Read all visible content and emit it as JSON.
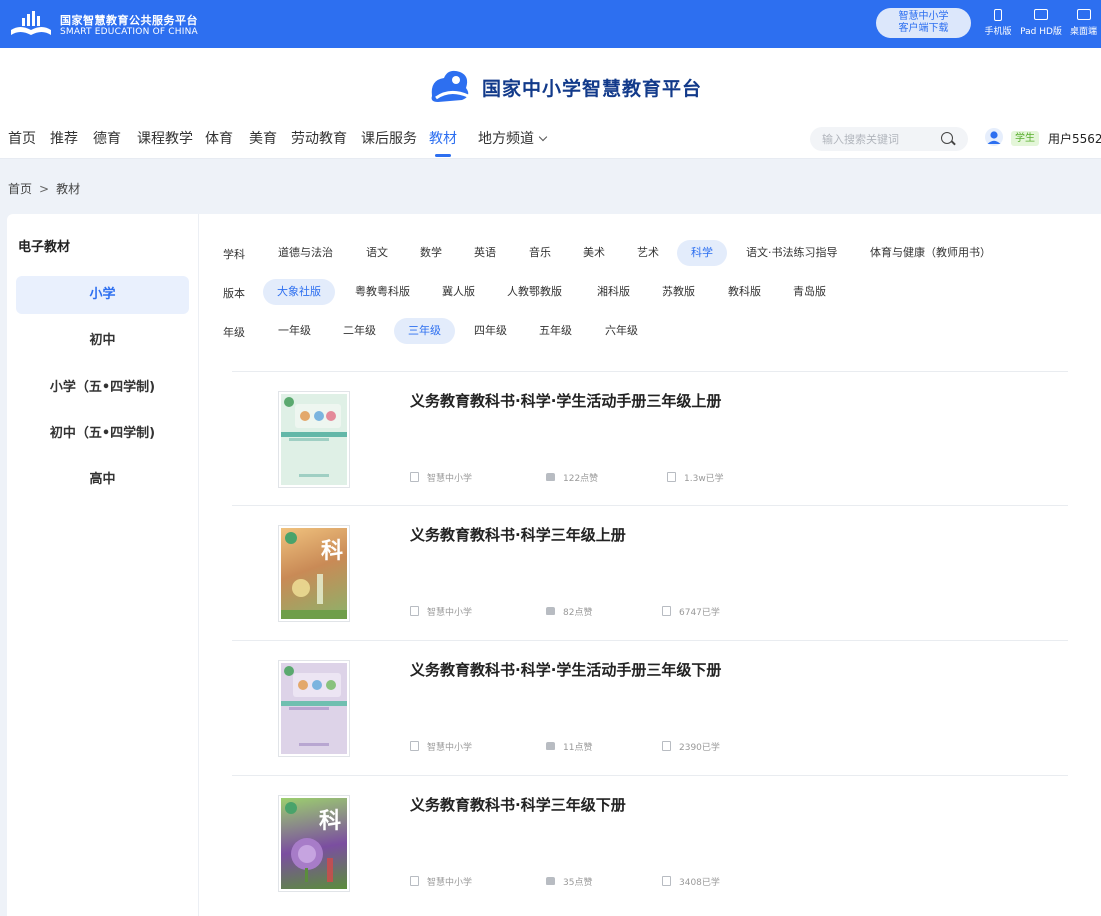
{
  "topbar": {
    "logo_cn": "国家智慧教育公共服务平台",
    "logo_en": "SMART EDUCATION OF CHINA",
    "download_line1": "智慧中小学",
    "download_line2": "客户端下载",
    "devices": [
      "手机版",
      "Pad HD版",
      "桌面端"
    ]
  },
  "header": {
    "brand": "国家中小学智慧教育平台",
    "nav": [
      "首页",
      "推荐",
      "德育",
      "课程教学",
      "体育",
      "美育",
      "劳动教育",
      "课后服务",
      "教材",
      "地方频道"
    ],
    "active_nav": "教材",
    "search_placeholder": "输入搜索关键词",
    "role": "学生",
    "username": "用户5562"
  },
  "breadcrumb": {
    "home": "首页",
    "sep": ">",
    "current": "教材"
  },
  "sidebar": {
    "title": "电子教材",
    "items": [
      "小学",
      "初中",
      "小学（五•四学制)",
      "初中（五•四学制)",
      "高中"
    ],
    "active": "小学"
  },
  "filters": {
    "subject_label": "学科",
    "subjects": [
      "道德与法治",
      "语文",
      "数学",
      "英语",
      "音乐",
      "美术",
      "艺术",
      "科学",
      "语文·书法练习指导",
      "体育与健康（教师用书）"
    ],
    "active_subject": "科学",
    "edition_label": "版本",
    "editions": [
      "大象社版",
      "粤教粤科版",
      "冀人版",
      "人教鄂教版",
      "湘科版",
      "苏教版",
      "教科版",
      "青岛版"
    ],
    "active_edition": "大象社版",
    "grade_label": "年级",
    "grades": [
      "一年级",
      "二年级",
      "三年级",
      "四年级",
      "五年级",
      "六年级"
    ],
    "active_grade": "三年级"
  },
  "books": [
    {
      "title": "义务教育教科书·科学·学生活动手册三年级上册",
      "source": "智慧中小学",
      "likes": "122点赞",
      "learners": "1.3w已学",
      "cover_color": "#dff0e6"
    },
    {
      "title": "义务教育教科书·科学三年级上册",
      "source": "智慧中小学",
      "likes": "82点赞",
      "learners": "6747已学",
      "cover_color": "#d9a36a"
    },
    {
      "title": "义务教育教科书·科学·学生活动手册三年级下册",
      "source": "智慧中小学",
      "likes": "11点赞",
      "learners": "2390已学",
      "cover_color": "#ddd3e8"
    },
    {
      "title": "义务教育教科书·科学三年级下册",
      "source": "智慧中小学",
      "likes": "35点赞",
      "learners": "3408已学",
      "cover_color": "#7b4ea0"
    }
  ]
}
